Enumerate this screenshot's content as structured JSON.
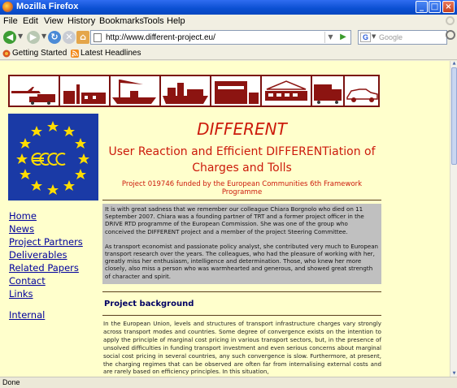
{
  "window": {
    "title": "Mozilla Firefox"
  },
  "menu": {
    "items": [
      "File",
      "Edit",
      "View",
      "History",
      "Bookmarks",
      "Tools",
      "Help"
    ]
  },
  "navigation": {
    "url": "http://www.different-project.eu/",
    "search_placeholder": "Google"
  },
  "bookmarks": {
    "items": [
      "Getting Started",
      "Latest Headlines"
    ]
  },
  "header": {
    "title": "DIFFERENT",
    "subtitle": "User Reaction and Efficient DIFFERENTiation of Charges and Tolls",
    "funded": "Project 019746 funded by the European Communities 6th Framework Programme"
  },
  "sidebar": {
    "links": [
      "Home",
      "News",
      "Project Partners",
      "Deliverables",
      "Related Papers",
      "Contact",
      "Links"
    ],
    "internal": "Internal"
  },
  "memorial": {
    "paragraph1": "It is with great sadness that we remember our colleague Chiara Borgnolo who died on 11 September 2007. Chiara was a founding partner of TRT and a former project officer in the DRIVE RTD programme of the European Commission. She was one of the group who conceived the DIFFERENT project and a member of the project Steering Committee.",
    "paragraph2": "As transport economist and passionate policy analyst, she contributed very much to European transport research over the years. The colleagues, who had the pleasure of working with her, greatly miss her enthusiasm, intelligence and determination. Those, who knew her more closely, also miss a person who was warmhearted and generous, and showed great strength of character and spirit."
  },
  "background": {
    "heading": "Project background",
    "text": "In the European Union, levels and structures of transport infrastructure charges vary strongly across transport modes and countries. Some degree of convergence exists on the intention to apply the principle of marginal cost pricing in various transport sectors, but, in the presence of unsolved difficulties in funding transport investment and even serious concerns about marginal social cost pricing in several countries, any such convergence is slow. Furthermore, at present, the charging regimes that can be observed are often far from internalising external costs and are rarely based on efficiency principles. In this situation,"
  },
  "status": {
    "text": "Done"
  },
  "colors": {
    "page_background": "#ffffcc",
    "title_red": "#cc1a0b",
    "link_blue": "#00009c",
    "banner_border": "#7a1210",
    "flag_blue": "#1a3aa6",
    "star_yellow": "#ffdd00"
  }
}
